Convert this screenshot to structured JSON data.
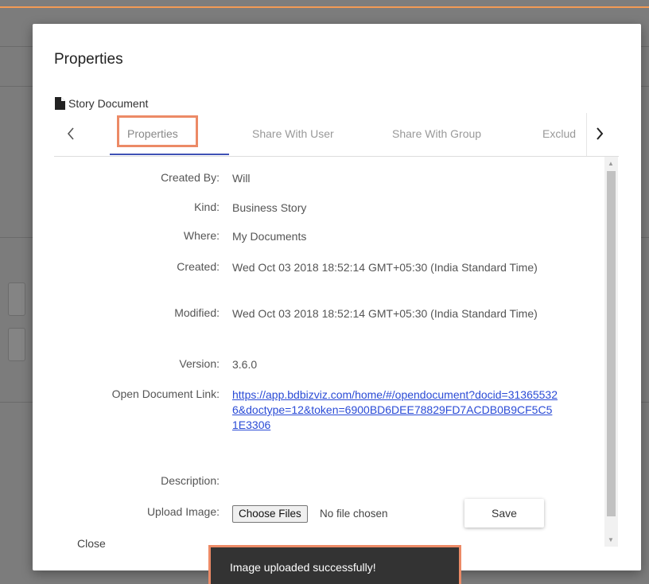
{
  "dialog": {
    "title": "Properties",
    "document_name": "Story Document",
    "document_icon": "file-icon"
  },
  "tabs": [
    {
      "label": "Properties",
      "active": true
    },
    {
      "label": "Share With User",
      "active": false
    },
    {
      "label": "Share With Group",
      "active": false
    },
    {
      "label": "Exclud",
      "active": false
    }
  ],
  "properties": {
    "created_by": {
      "label": "Created By:",
      "value": "Will"
    },
    "kind": {
      "label": "Kind:",
      "value": "Business Story"
    },
    "where": {
      "label": "Where:",
      "value": "My Documents"
    },
    "created": {
      "label": "Created:",
      "value": "Wed Oct 03 2018 18:52:14 GMT+05:30 (India Standard Time)"
    },
    "modified": {
      "label": "Modified:",
      "value": "Wed Oct 03 2018 18:52:14 GMT+05:30 (India Standard Time)"
    },
    "version": {
      "label": "Version:",
      "value": "3.6.0"
    },
    "link": {
      "label": "Open Document Link:",
      "value": "https://app.bdbizviz.com/home/#/opendocument?docid=313655326&doctype=12&token=6900BD6DEE78829FD7ACDB0B9CF5C51E3306"
    },
    "description": {
      "label": "Description:",
      "value": ""
    },
    "upload": {
      "label": "Upload Image:",
      "choose_label": "Choose Files",
      "file_status": "No file chosen"
    }
  },
  "actions": {
    "save_label": "Save",
    "close_label": "Close"
  },
  "toast": {
    "message": "Image uploaded successfully!"
  },
  "colors": {
    "accent_underline": "#3f51b5",
    "highlight_box": "#ec8a66",
    "link": "#2a4bd6",
    "toast_bg": "#333333"
  }
}
